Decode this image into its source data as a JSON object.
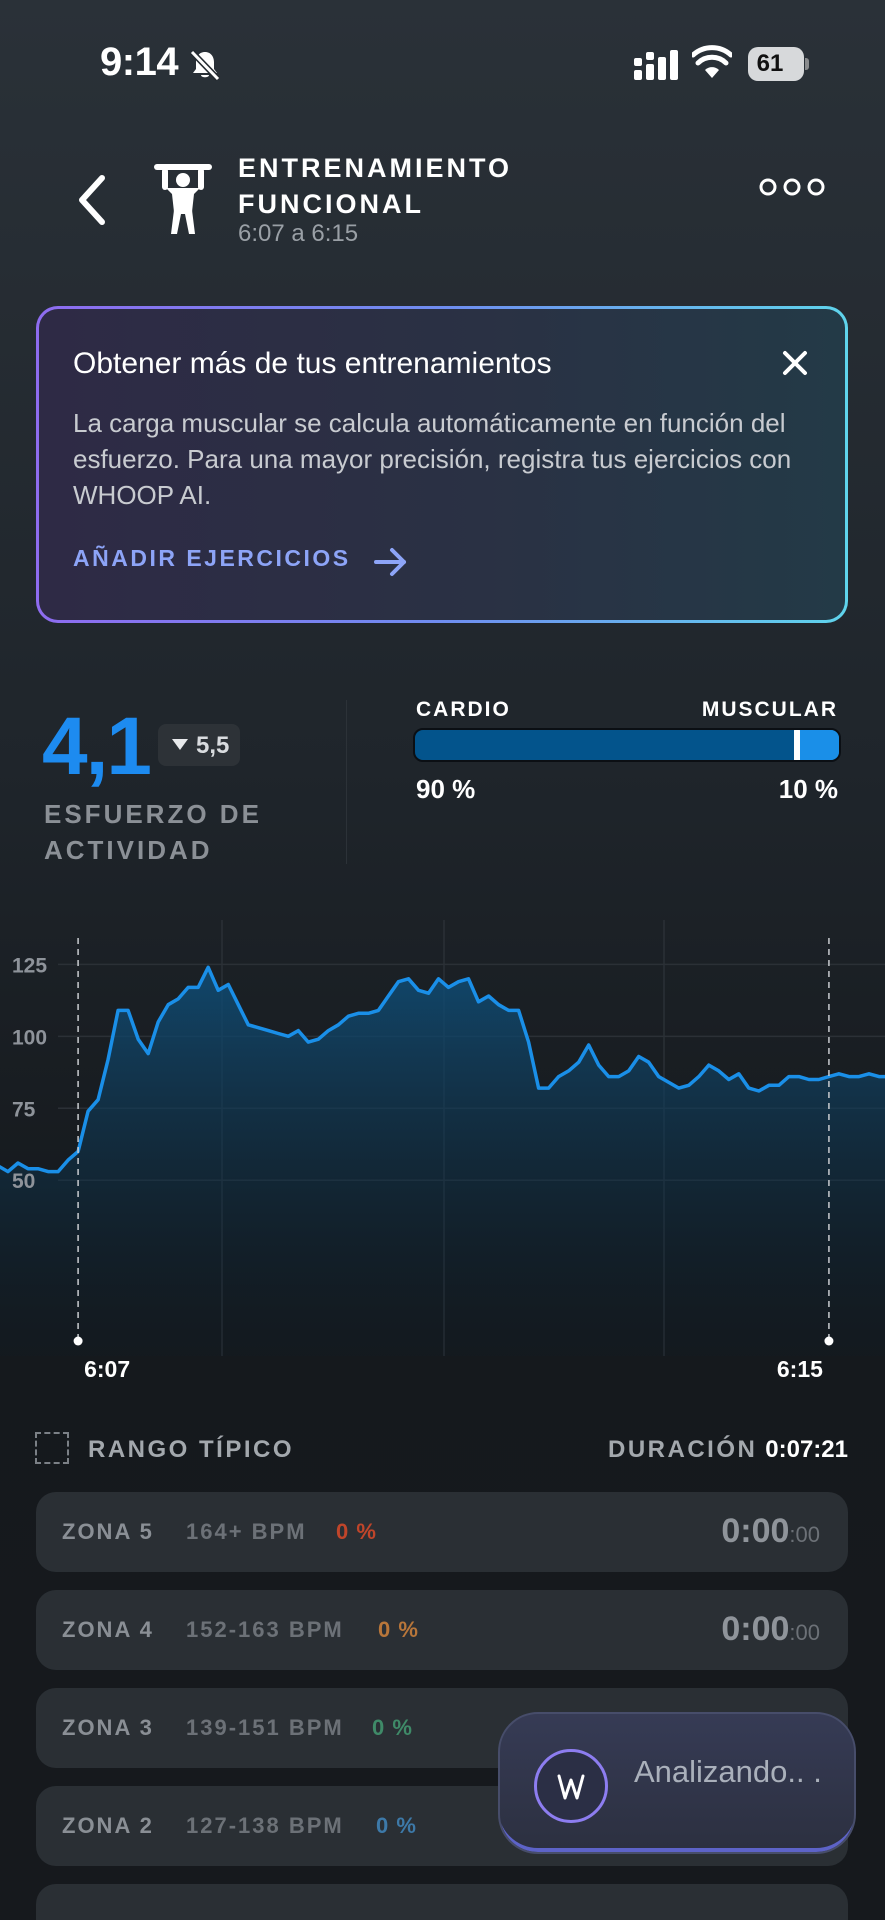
{
  "status_bar": {
    "time": "9:14",
    "battery": "61"
  },
  "header": {
    "title": "ENTRENAMIENTO FUNCIONAL",
    "time_range": "6:07 a 6:15"
  },
  "banner": {
    "title": "Obtener más de tus entrenamientos",
    "body": "La carga muscular se calcula automáticamente en función del esfuerzo. Para una mayor precisión, registra tus ejercicios con WHOOP AI.",
    "cta": "AÑADIR EJERCICIOS"
  },
  "effort": {
    "value": "4,1",
    "change": "5,5",
    "label": "ESFUERZO DE ACTIVIDAD"
  },
  "load": {
    "cardio_label": "CARDIO",
    "muscular_label": "MUSCULAR",
    "cardio_pct": "90 %",
    "muscular_pct": "10 %",
    "cardio_fraction": 0.9,
    "muscular_fraction": 0.1
  },
  "chart_data": {
    "type": "area",
    "yticks": [
      "125",
      "100",
      "75",
      "50"
    ],
    "ylim": [
      48,
      130
    ],
    "start_label": "6:07",
    "end_label": "6:15",
    "values": [
      55,
      53,
      56,
      54,
      54,
      53,
      53,
      57,
      60,
      74,
      78,
      92,
      109,
      109,
      99,
      94,
      105,
      111,
      113,
      117,
      117,
      124,
      116,
      118,
      111,
      104,
      103,
      102,
      101,
      100,
      102,
      98,
      99,
      102,
      104,
      107,
      108,
      108,
      109,
      114,
      119,
      120,
      116,
      115,
      120,
      117,
      119,
      120,
      112,
      114,
      111,
      109,
      109,
      98,
      82,
      82,
      86,
      88,
      91,
      97,
      90,
      86,
      86,
      88,
      93,
      91,
      86,
      84,
      82,
      83,
      86,
      90,
      88,
      85,
      87,
      82,
      81,
      83,
      83,
      86,
      86,
      85,
      85,
      86,
      87,
      86,
      86,
      87,
      86,
      86
    ],
    "workout_start_index": 8,
    "workout_end_index": 83
  },
  "legend": {
    "range_label": "RANGO TÍPICO",
    "duration_label": "DURACIÓN",
    "duration_value": "0:07:21"
  },
  "zones": [
    {
      "name": "ZONA 5",
      "bpm": "164+ BPM",
      "pct": "0 %",
      "time": "0:00",
      "time_sec": ":00",
      "color": "#c0452a"
    },
    {
      "name": "ZONA 4",
      "bpm": "152-163 BPM",
      "pct": "0 %",
      "time": "0:00",
      "time_sec": ":00",
      "color": "#b8763a"
    },
    {
      "name": "ZONA 3",
      "bpm": "139-151 BPM",
      "pct": "0 %",
      "time": "",
      "time_sec": "",
      "color": "#3f8a68"
    },
    {
      "name": "ZONA 2",
      "bpm": "127-138 BPM",
      "pct": "0 %",
      "time": "",
      "time_sec": "",
      "color": "#3d79a8"
    }
  ],
  "toast": {
    "text": "Analizando.. ."
  }
}
